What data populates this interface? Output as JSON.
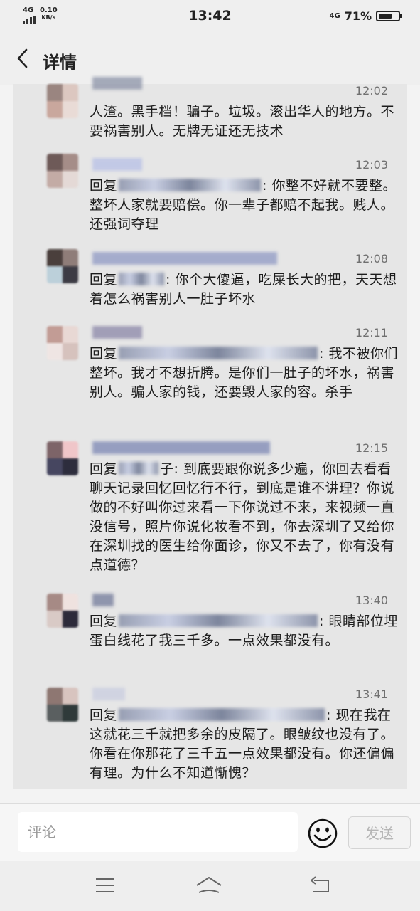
{
  "status": {
    "network": "4G",
    "speed": "0.10",
    "speed_unit": "KB/s",
    "time": "13:42",
    "network_right": "4G",
    "battery": "71%",
    "battery_level": 0.71
  },
  "header": {
    "title": "详情"
  },
  "messages": [
    {
      "time": "12:02",
      "text": "人渣。黑手档！骗子。垃圾。滚出华人的地方。不要祸害别人。无牌无证还无技术"
    },
    {
      "time": "12:03",
      "prefix": "回复",
      "text": ": 你整不好就不要整。整坏人家就要赔偿。你一辈子都赔不起我。贱人。还强词夺理"
    },
    {
      "time": "12:08",
      "prefix": "回复",
      "text": ": 你个大傻逼，吃屎长大的把，天天想着怎么祸害别人一肚子坏水"
    },
    {
      "time": "12:11",
      "prefix": "回复",
      "text": ": 我不被你们整坏。我才不想折腾。是你们一肚子的坏水，祸害别人。骗人家的钱，还要毁人家的容。杀手"
    },
    {
      "time": "12:15",
      "prefix": "回复",
      "text": "子: 到底要跟你说多少遍，你回去看看聊天记录回忆回忆行不行，到底是谁不讲理？你说做的不好叫你过来看一下你说过不来，来视频一直没信号，照片你说化妆看不到，你去深圳了又给你在深圳找的医生给你面诊，你又不去了，你有没有点道德？"
    },
    {
      "time": "13:40",
      "prefix": "回复",
      "text": ": 眼睛部位埋蛋白线花了我三千多。一点效果都没有。"
    },
    {
      "time": "13:41",
      "prefix": "回复",
      "text": ": 现在我在这就花三千就把多余的皮隔了。眼皱纹也没有了。你看在你那花了三千五一点效果都没有。你还偏偏有理。为什么不知道惭愧？"
    }
  ],
  "comment": {
    "placeholder": "评论",
    "send_label": "发送"
  },
  "icons": {
    "back": "chevron-left-icon",
    "emoji": "smiley-icon",
    "menu": "menu-icon",
    "home": "home-icon",
    "return": "return-icon"
  },
  "colors": {
    "background": "#f3f3f3",
    "card": "#e6e6e6",
    "send_text": "#b5b5b5"
  }
}
